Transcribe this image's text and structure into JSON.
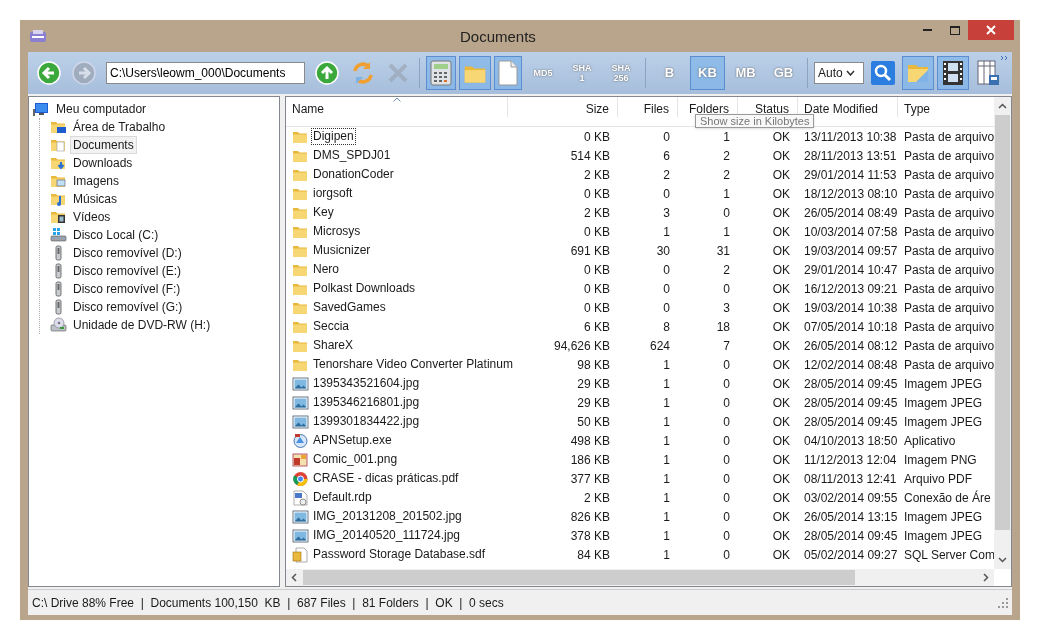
{
  "window": {
    "title": "Documents"
  },
  "toolbar": [
    {
      "kind": "back",
      "selected": false,
      "disabled": false
    },
    {
      "kind": "forward",
      "selected": false,
      "disabled": true
    },
    {
      "kind": "path",
      "value": "C:\\Users\\leowm_000\\Documents"
    },
    {
      "kind": "up",
      "selected": false,
      "disabled": false
    },
    {
      "kind": "refresh",
      "selected": false,
      "disabled": false
    },
    {
      "kind": "stop",
      "selected": false,
      "disabled": true
    },
    {
      "kind": "calculator",
      "selected": true,
      "disabled": false
    },
    {
      "kind": "folder",
      "selected": true,
      "disabled": false
    },
    {
      "kind": "file",
      "selected": true,
      "disabled": false
    },
    {
      "kind": "hash",
      "label": "MD5",
      "selected": false,
      "disabled": false
    },
    {
      "kind": "hash",
      "label": "SHA",
      "sublabel": "1",
      "selected": false,
      "disabled": false
    },
    {
      "kind": "hash",
      "label": "SHA",
      "sublabel": "256",
      "selected": false,
      "disabled": false
    },
    {
      "kind": "unit",
      "label": "B",
      "selected": false,
      "disabled": false
    },
    {
      "kind": "unit",
      "label": "KB",
      "selected": true,
      "disabled": false
    },
    {
      "kind": "unit",
      "label": "MB",
      "selected": false,
      "disabled": false
    },
    {
      "kind": "unit",
      "label": "GB",
      "selected": false,
      "disabled": false
    },
    {
      "kind": "select",
      "value": "Auto"
    },
    {
      "kind": "search",
      "selected": false,
      "disabled": false
    },
    {
      "kind": "folderview",
      "selected": true,
      "disabled": false
    },
    {
      "kind": "film",
      "selected": true,
      "disabled": false
    },
    {
      "kind": "columns",
      "selected": false,
      "disabled": false
    }
  ],
  "tree": {
    "label": "Meu computador",
    "kind": "computer",
    "selected": false,
    "children": [
      {
        "label": "Área de Trabalho",
        "kind": "desktop",
        "selected": false
      },
      {
        "label": "Documents",
        "kind": "documents",
        "selected": true
      },
      {
        "label": "Downloads",
        "kind": "downloads",
        "selected": false
      },
      {
        "label": "Imagens",
        "kind": "pictures",
        "selected": false
      },
      {
        "label": "Músicas",
        "kind": "music",
        "selected": false
      },
      {
        "label": "Vídeos",
        "kind": "videos",
        "selected": false
      },
      {
        "label": "Disco Local (C:)",
        "kind": "hdd",
        "selected": false
      },
      {
        "label": "Disco removível (D:)",
        "kind": "usb",
        "selected": false
      },
      {
        "label": "Disco removível (E:)",
        "kind": "usb",
        "selected": false
      },
      {
        "label": "Disco removível (F:)",
        "kind": "usb",
        "selected": false
      },
      {
        "label": "Disco removível (G:)",
        "kind": "usb",
        "selected": false
      },
      {
        "label": "Unidade de DVD-RW (H:)",
        "kind": "dvd",
        "selected": false
      }
    ]
  },
  "table": {
    "columns": [
      "Name",
      "Size",
      "Files",
      "Folders",
      "Status",
      "Date Modified",
      "Type"
    ],
    "rows": [
      {
        "kind": "folder",
        "name": "Digipen",
        "size": "0 KB",
        "files": "0",
        "folders": "1",
        "status": "OK",
        "modified": "13/11/2013 10:38",
        "type": "Pasta de arquivo",
        "focused": true
      },
      {
        "kind": "folder",
        "name": "DMS_SPDJ01",
        "size": "514 KB",
        "files": "6",
        "folders": "2",
        "status": "OK",
        "modified": "28/11/2013 13:51",
        "type": "Pasta de arquivo",
        "focused": false
      },
      {
        "kind": "folder",
        "name": "DonationCoder",
        "size": "2 KB",
        "files": "2",
        "folders": "2",
        "status": "OK",
        "modified": "29/01/2014 11:53",
        "type": "Pasta de arquivo",
        "focused": false
      },
      {
        "kind": "folder",
        "name": "iorgsoft",
        "size": "0 KB",
        "files": "0",
        "folders": "1",
        "status": "OK",
        "modified": "18/12/2013 08:10",
        "type": "Pasta de arquivo",
        "focused": false
      },
      {
        "kind": "folder",
        "name": "Key",
        "size": "2 KB",
        "files": "3",
        "folders": "0",
        "status": "OK",
        "modified": "26/05/2014 08:49",
        "type": "Pasta de arquivo",
        "focused": false
      },
      {
        "kind": "folder",
        "name": "Microsys",
        "size": "0 KB",
        "files": "1",
        "folders": "1",
        "status": "OK",
        "modified": "10/03/2014 07:58",
        "type": "Pasta de arquivo",
        "focused": false
      },
      {
        "kind": "folder",
        "name": "Musicnizer",
        "size": "691 KB",
        "files": "30",
        "folders": "31",
        "status": "OK",
        "modified": "19/03/2014 09:57",
        "type": "Pasta de arquivo",
        "focused": false
      },
      {
        "kind": "folder",
        "name": "Nero",
        "size": "0 KB",
        "files": "0",
        "folders": "2",
        "status": "OK",
        "modified": "29/01/2014 10:47",
        "type": "Pasta de arquivo",
        "focused": false
      },
      {
        "kind": "folder",
        "name": "Polkast Downloads",
        "size": "0 KB",
        "files": "0",
        "folders": "0",
        "status": "OK",
        "modified": "16/12/2013 09:21",
        "type": "Pasta de arquivo",
        "focused": false
      },
      {
        "kind": "folder",
        "name": "SavedGames",
        "size": "0 KB",
        "files": "0",
        "folders": "3",
        "status": "OK",
        "modified": "19/03/2014 10:38",
        "type": "Pasta de arquivo",
        "focused": false
      },
      {
        "kind": "folder",
        "name": "Seccia",
        "size": "6 KB",
        "files": "8",
        "folders": "18",
        "status": "OK",
        "modified": "07/05/2014 10:18",
        "type": "Pasta de arquivo",
        "focused": false
      },
      {
        "kind": "folder",
        "name": "ShareX",
        "size": "94,626 KB",
        "files": "624",
        "folders": "7",
        "status": "OK",
        "modified": "26/05/2014 08:12",
        "type": "Pasta de arquivo",
        "focused": false
      },
      {
        "kind": "folder",
        "name": "Tenorshare Video Converter Platinum",
        "size": "98 KB",
        "files": "1",
        "folders": "0",
        "status": "OK",
        "modified": "12/02/2014 08:48",
        "type": "Pasta de arquivo",
        "focused": false
      },
      {
        "kind": "image",
        "name": "1395343521604.jpg",
        "size": "29 KB",
        "files": "1",
        "folders": "0",
        "status": "OK",
        "modified": "28/05/2014 09:45",
        "type": "Imagem JPEG",
        "focused": false
      },
      {
        "kind": "image",
        "name": "1395346216801.jpg",
        "size": "29 KB",
        "files": "1",
        "folders": "0",
        "status": "OK",
        "modified": "28/05/2014 09:45",
        "type": "Imagem JPEG",
        "focused": false
      },
      {
        "kind": "image",
        "name": "1399301834422.jpg",
        "size": "50 KB",
        "files": "1",
        "folders": "0",
        "status": "OK",
        "modified": "28/05/2014 09:45",
        "type": "Imagem JPEG",
        "focused": false
      },
      {
        "kind": "setup",
        "name": "APNSetup.exe",
        "size": "498 KB",
        "files": "1",
        "folders": "0",
        "status": "OK",
        "modified": "04/10/2013 18:50",
        "type": "Aplicativo",
        "focused": false
      },
      {
        "kind": "png",
        "name": "Comic_001.png",
        "size": "186 KB",
        "files": "1",
        "folders": "0",
        "status": "OK",
        "modified": "11/12/2013 12:04",
        "type": "Imagem PNG",
        "focused": false
      },
      {
        "kind": "pdf",
        "name": "CRASE - dicas práticas.pdf",
        "size": "377 KB",
        "files": "1",
        "folders": "0",
        "status": "OK",
        "modified": "08/11/2013 12:41",
        "type": "Arquivo PDF",
        "focused": false
      },
      {
        "kind": "rdp",
        "name": "Default.rdp",
        "size": "2 KB",
        "files": "1",
        "folders": "0",
        "status": "OK",
        "modified": "03/02/2014 09:55",
        "type": "Conexão de Áre",
        "focused": false
      },
      {
        "kind": "image",
        "name": "IMG_20131208_201502.jpg",
        "size": "826 KB",
        "files": "1",
        "folders": "0",
        "status": "OK",
        "modified": "26/05/2014 13:15",
        "type": "Imagem JPEG",
        "focused": false
      },
      {
        "kind": "image",
        "name": "IMG_20140520_111724.jpg",
        "size": "378 KB",
        "files": "1",
        "folders": "0",
        "status": "OK",
        "modified": "28/05/2014 09:45",
        "type": "Imagem JPEG",
        "focused": false
      },
      {
        "kind": "sdf",
        "name": "Password Storage Database.sdf",
        "size": "84 KB",
        "files": "1",
        "folders": "0",
        "status": "OK",
        "modified": "05/02/2014 09:27",
        "type": "SQL Server Com",
        "focused": false
      }
    ]
  },
  "tooltip": "Show size in Kilobytes",
  "status_bar": "C:\\ Drive 88% Free  |  Documents 100,150  KB  |  687 Files  |  81 Folders  |  OK  |  0 secs"
}
